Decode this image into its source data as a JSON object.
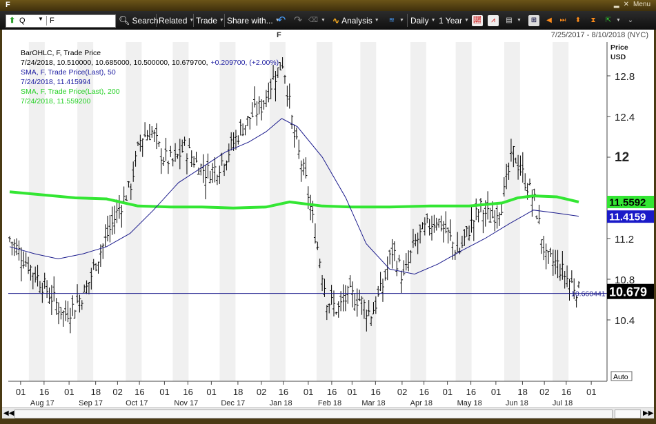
{
  "window": {
    "title": "F",
    "menu_label": "Menu"
  },
  "toolbar": {
    "symbol_type": "Q",
    "symbol_value": "F",
    "search_label": "Search",
    "related_label": "Related",
    "trade_label": "Trade",
    "share_label": "Share with...",
    "analysis_label": "Analysis",
    "period_label": "Daily",
    "range_label": "1 Year"
  },
  "chart_header": {
    "symbol": "F",
    "date_range": "7/25/2017 - 8/10/2018 (NYC)"
  },
  "legend": {
    "ohlc_line1": "BarOHLC, F, Trade Price",
    "ohlc_line2_values": "7/24/2018, 10.510000, 10.685000, 10.500000, 10.679700,",
    "ohlc_line2_change": "+0.209700, (+2.00%)",
    "sma50_line1": "SMA, F, Trade Price(Last), 50",
    "sma50_line2": "7/24/2018, 11.415994",
    "sma200_line1": "SMA, F, Trade Price(Last), 200",
    "sma200_line2": "7/24/2018, 11.559200"
  },
  "price_axis": {
    "title_line1": "Price",
    "title_line2": "USD",
    "auto_label": "Auto"
  },
  "price_badges": {
    "sma200": "11.5592",
    "sma50": "11.4159",
    "last": "10.679",
    "hline": "10.660441"
  },
  "colors": {
    "sma200": "#33e633",
    "sma50": "#1a1a8c",
    "bars": "#000000",
    "last_badge": "#000000",
    "band": "#f0f0f0"
  },
  "chart_data": {
    "type": "line",
    "series": [
      {
        "name": "SMA, F, Trade Price(Last), 200",
        "x": [
          "2017-07-25",
          "2017-08-15",
          "2017-09-05",
          "2017-09-25",
          "2017-10-15",
          "2017-11-05",
          "2017-11-25",
          "2017-12-15",
          "2018-01-05",
          "2018-01-20",
          "2018-02-10",
          "2018-03-01",
          "2018-03-25",
          "2018-04-20",
          "2018-05-15",
          "2018-06-05",
          "2018-06-15",
          "2018-06-25",
          "2018-07-10",
          "2018-07-24"
        ],
        "values": [
          11.66,
          11.63,
          11.6,
          11.59,
          11.52,
          11.51,
          11.51,
          11.5,
          11.51,
          11.56,
          11.52,
          11.51,
          11.51,
          11.52,
          11.52,
          11.55,
          11.6,
          11.62,
          11.61,
          11.56
        ]
      },
      {
        "name": "SMA, F, Trade Price(Last), 50",
        "x": [
          "2017-07-25",
          "2017-08-10",
          "2017-08-25",
          "2017-09-10",
          "2017-09-25",
          "2017-10-10",
          "2017-10-25",
          "2017-11-10",
          "2017-11-25",
          "2017-12-10",
          "2017-12-25",
          "2018-01-05",
          "2018-01-15",
          "2018-01-25",
          "2018-02-10",
          "2018-02-25",
          "2018-03-10",
          "2018-03-25",
          "2018-04-10",
          "2018-04-25",
          "2018-05-10",
          "2018-05-25",
          "2018-06-10",
          "2018-06-25",
          "2018-07-10",
          "2018-07-24"
        ],
        "values": [
          11.12,
          11.05,
          11.0,
          11.05,
          11.12,
          11.25,
          11.48,
          11.75,
          11.9,
          12.05,
          12.15,
          12.25,
          12.38,
          12.3,
          12.0,
          11.6,
          11.15,
          10.9,
          10.85,
          10.95,
          11.08,
          11.2,
          11.35,
          11.48,
          11.45,
          11.42
        ]
      }
    ],
    "ohlc_last": {
      "date": "7/24/2018",
      "open": 10.51,
      "high": 10.685,
      "low": 10.5,
      "close": 10.6797
    },
    "price_series_close": {
      "x_start": "2017-07-25",
      "x_end": "2018-07-24",
      "approx_closes": [
        11.2,
        11.05,
        10.9,
        10.75,
        10.6,
        10.45,
        10.55,
        10.7,
        11.0,
        11.25,
        11.5,
        11.7,
        12.2,
        12.25,
        12.0,
        11.95,
        12.1,
        11.95,
        11.85,
        11.9,
        12.05,
        12.25,
        12.4,
        12.5,
        12.75,
        12.95,
        12.2,
        11.8,
        11.2,
        10.6,
        10.5,
        10.65,
        10.6,
        10.45,
        10.7,
        11.1,
        10.8,
        11.15,
        11.3,
        11.4,
        11.25,
        11.05,
        11.3,
        11.5,
        11.4,
        11.55,
        12.05,
        11.8,
        11.55,
        11.0,
        10.95,
        10.8,
        10.68
      ]
    },
    "y_ticks": [
      "10.4",
      "10.8",
      "11.2",
      "12",
      "12.4",
      "12.8"
    ],
    "x_day_labels": [
      "01",
      "16",
      "01",
      "18",
      "02",
      "16",
      "01",
      "16",
      "01",
      "18",
      "02",
      "16",
      "01",
      "16",
      "01",
      "16",
      "02",
      "16",
      "01",
      "16",
      "01",
      "18",
      "02",
      "16",
      "01"
    ],
    "x_month_labels": [
      "Aug 17",
      "Sep 17",
      "Oct 17",
      "Nov 17",
      "Dec 17",
      "Jan 18",
      "Feb 18",
      "Mar 18",
      "Apr 18",
      "May 18",
      "Jun 18",
      "Jul 18"
    ],
    "ylim": [
      10.2,
      13.1
    ],
    "grid": true,
    "legend_position": "top-left"
  }
}
